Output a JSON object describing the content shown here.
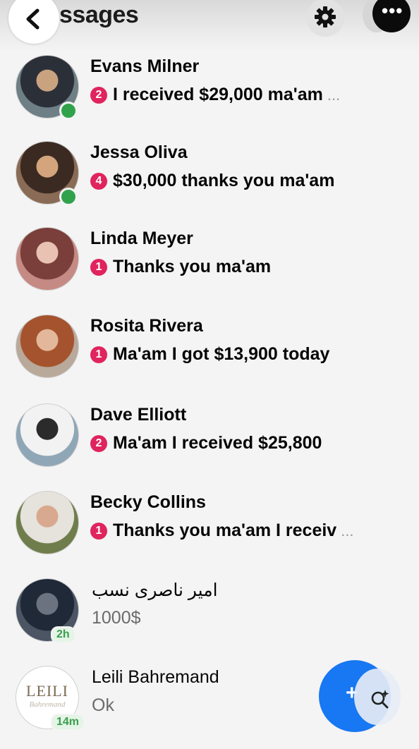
{
  "header": {
    "title": "ssages",
    "back_icon": "chevron-left-icon",
    "settings_icon": "gear-icon",
    "more_icon": "more-dots-icon",
    "more_label": "•••"
  },
  "conversations": [
    {
      "name": "Evans Milner",
      "unread": "2",
      "preview": "I received $29,000 ma'am",
      "truncated": "...",
      "online": true,
      "avatar": {
        "colors": [
          "#6e7f86",
          "#2b2f38",
          "#c9a27f"
        ]
      }
    },
    {
      "name": "Jessa Oliva",
      "unread": "4",
      "preview": "$30,000 thanks you ma'am",
      "online": true,
      "avatar": {
        "colors": [
          "#8a6b55",
          "#3a2a22",
          "#d4a47d"
        ]
      }
    },
    {
      "name": "Linda Meyer",
      "unread": "1",
      "preview": "Thanks you ma'am",
      "online": false,
      "avatar": {
        "colors": [
          "#c68a84",
          "#7a3f3a",
          "#e9c2b3"
        ]
      }
    },
    {
      "name": "Rosita Rivera",
      "unread": "1",
      "preview": "Ma'am I got $13,900 today",
      "online": false,
      "avatar": {
        "colors": [
          "#b8a99a",
          "#a5532e",
          "#e3b79a"
        ]
      }
    },
    {
      "name": "Dave Elliott",
      "unread": "2",
      "preview": "Ma'am I received $25,800",
      "online": false,
      "avatar": {
        "colors": [
          "#8fa6b6",
          "#f2f2f2",
          "#2b2b2b"
        ]
      }
    },
    {
      "name": "Becky Collins",
      "unread": "1",
      "preview": "Thanks you ma'am I receiv",
      "truncated": "...",
      "online": false,
      "avatar": {
        "colors": [
          "#6f7d4c",
          "#e6e2dc",
          "#d8a98e"
        ]
      }
    },
    {
      "name": "امیر ناصری نسب",
      "preview": "1000$",
      "time": "2h",
      "online": false,
      "avatar": {
        "colors": [
          "#4b5563",
          "#1f2937",
          "#6b7280"
        ]
      }
    },
    {
      "name": "Leili Bahremand",
      "preview": "Ok",
      "time": "14m",
      "online": false,
      "avatar": {
        "logo_text": "LEILI",
        "logo_sub": "Bahremand",
        "colors": [
          "#ffffff",
          "#7a6a55",
          "#bfb6a8"
        ]
      }
    }
  ],
  "fab": {
    "icon": "plus-icon",
    "overlay_icon": "search-sparkle-icon",
    "accent": "#1877f2"
  },
  "colors": {
    "unread_badge": "#e0245e",
    "online": "#31a24c",
    "time_badge_text": "#3b9e4d"
  }
}
